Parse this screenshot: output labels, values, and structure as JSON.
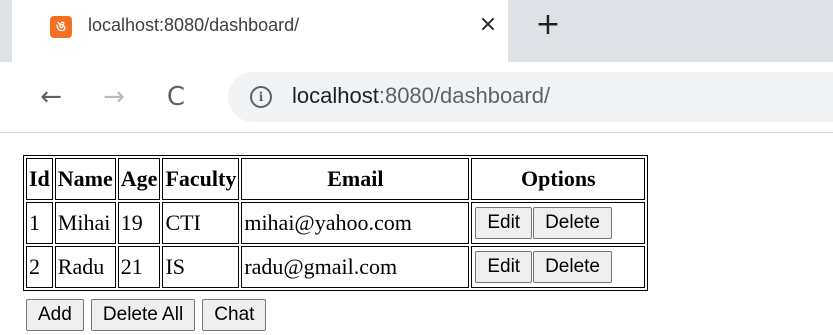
{
  "browser": {
    "tab_title": "localhost:8080/dashboard/",
    "favicon_glyph": "ঙ",
    "close_glyph": "×",
    "new_tab_glyph": "+",
    "url_host": "localhost",
    "url_path": ":8080/dashboard/",
    "icons": {
      "back": "←",
      "forward": "→",
      "reload": "C",
      "info": "i"
    }
  },
  "table": {
    "headers": [
      "Id",
      "Name",
      "Age",
      "Faculty",
      "Email",
      "Options"
    ],
    "rows": [
      {
        "id": "1",
        "name": "Mihai",
        "age": "19",
        "faculty": "CTI",
        "email": "mihai@yahoo.com",
        "edit_label": "Edit",
        "delete_label": "Delete"
      },
      {
        "id": "2",
        "name": "Radu",
        "age": "21",
        "faculty": "IS",
        "email": "radu@gmail.com",
        "edit_label": "Edit",
        "delete_label": "Delete"
      }
    ]
  },
  "actions": {
    "add_label": "Add",
    "delete_all_label": "Delete All",
    "chat_label": "Chat"
  },
  "colors": {
    "favicon": "#f37021",
    "tabstrip": "#dee1e6",
    "omnibox": "#f1f3f4"
  }
}
